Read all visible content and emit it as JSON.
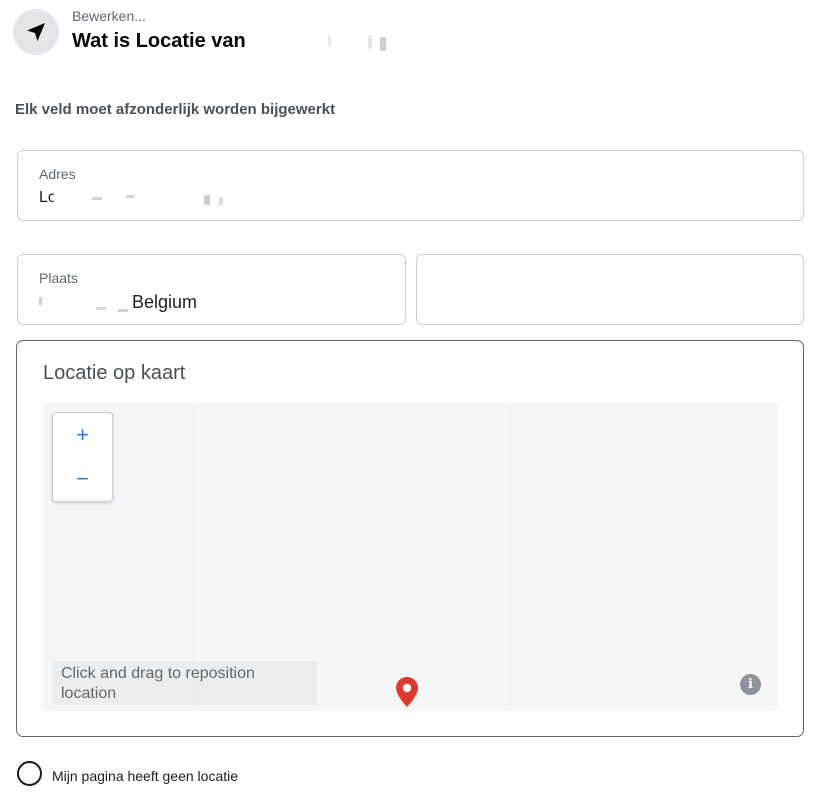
{
  "header": {
    "icon": "navigation-arrow-icon",
    "subtitle": "Bewerken...",
    "title": "Wat is Locatie van"
  },
  "instruction": "Elk veld moet afzonderlijk worden bijgewerkt",
  "address": {
    "label": "Adres",
    "value": "Lo"
  },
  "city": {
    "label": "Plaats",
    "value": "Belgium"
  },
  "extra_field": {
    "value": ""
  },
  "map": {
    "title": "Locatie op kaart",
    "zoom_in": "+",
    "zoom_out": "−",
    "hint": "Click and drag to reposition location",
    "pin": "location-pin-icon",
    "info": "i"
  },
  "no_location": {
    "label": "Mijn pagina heeft geen locatie",
    "checked": false
  },
  "colors": {
    "pin": "#e0392b",
    "zoom": "#3578e5",
    "border": "#ccd0d5"
  }
}
